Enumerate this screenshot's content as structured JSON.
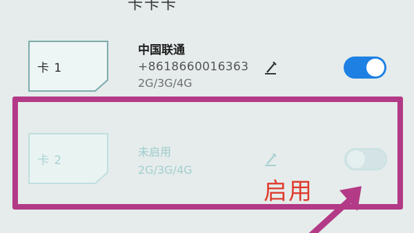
{
  "top_fragment": "卡卡卡",
  "sim_slots": [
    {
      "card_label": "卡 1",
      "carrier": "中国联通",
      "number": "+8618660016363",
      "network": "2G/3G/4G",
      "enabled": true
    },
    {
      "card_label": "卡 2",
      "carrier": "未启用",
      "network": "2G/3G/4G",
      "enabled": false
    }
  ],
  "annotation": {
    "label": "启用",
    "box_color": "#b33a86",
    "label_color": "#e0392c"
  },
  "colors": {
    "toggle_on": "#1e80e3",
    "toggle_off": "#d4e4e6",
    "disabled_text": "#9dcccc"
  }
}
